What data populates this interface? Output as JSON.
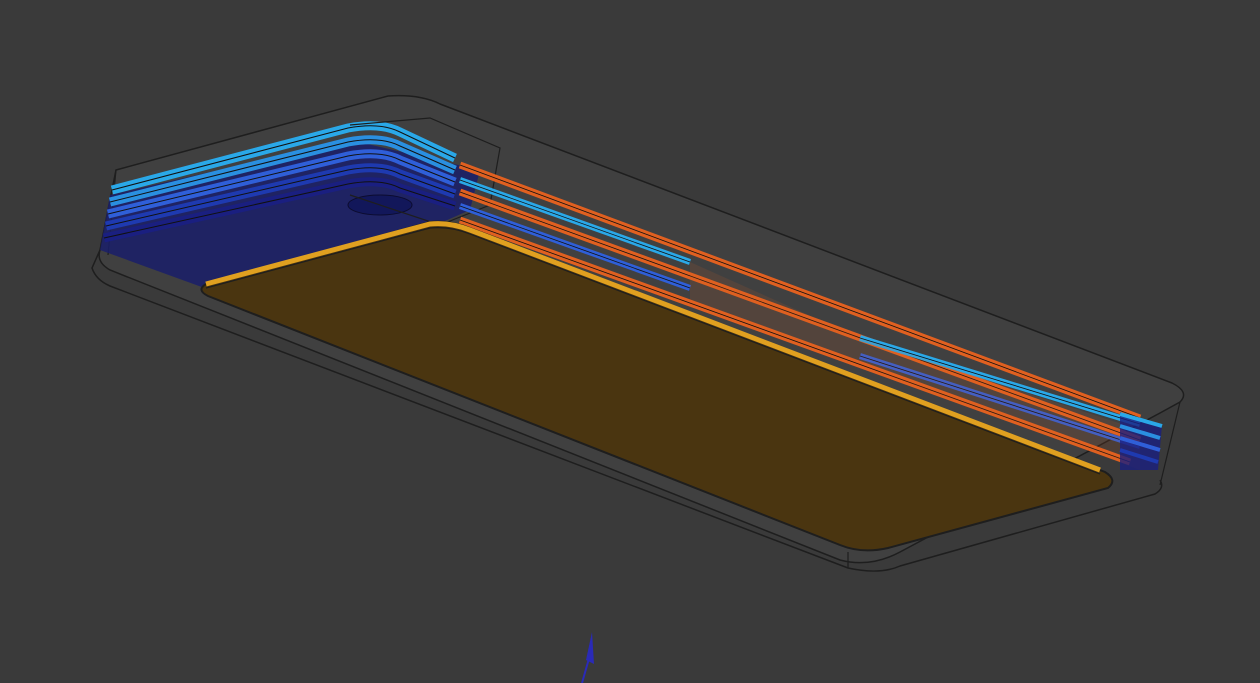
{
  "viewport": {
    "background_color": "#3a3a3a"
  },
  "model": {
    "stock_outline_color": "#1e1e1e",
    "stock_face_color": "#404040",
    "floor_fill_color": "#4a3510",
    "floor_edge_color": "#e0a020",
    "toolpath_colors": {
      "dark_blue": "#1a1f80",
      "blue": "#2f5fd8",
      "light_blue": "#2aa8e8",
      "orange": "#e06020"
    }
  },
  "axis": {
    "icon": "z-axis-arrow-icon",
    "color": "#2a2ab8"
  }
}
